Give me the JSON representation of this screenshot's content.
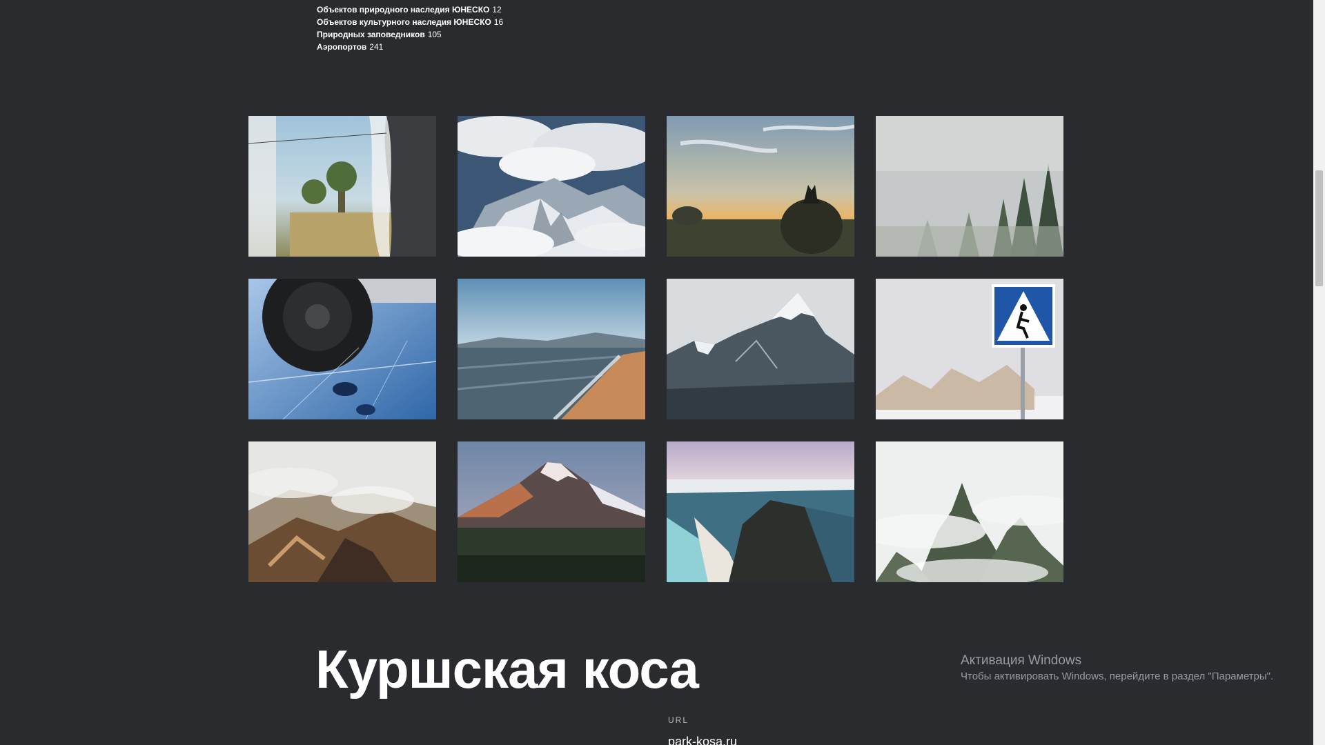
{
  "stats": [
    {
      "label": "Объектов природного наследия ЮНЕСКО",
      "value": "12"
    },
    {
      "label": "Объектов культурного наследия ЮНЕСКО",
      "value": "16"
    },
    {
      "label": "Природных заповедников",
      "value": "105"
    },
    {
      "label": "Аэропортов",
      "value": "241"
    }
  ],
  "gallery": {
    "photos": [
      {
        "subject": "train-window-photo"
      },
      {
        "subject": "clouds-over-mountains-photo"
      },
      {
        "subject": "wolf-on-hay-bale-photo"
      },
      {
        "subject": "foggy-forest-photo"
      },
      {
        "subject": "car-wheel-on-ice-photo"
      },
      {
        "subject": "lake-shore-photo"
      },
      {
        "subject": "snowy-peak-photo"
      },
      {
        "subject": "crosswalk-sign-photo"
      },
      {
        "subject": "volcanic-valley-photo"
      },
      {
        "subject": "volcano-photo"
      },
      {
        "subject": "coastal-cliff-photo"
      },
      {
        "subject": "misty-peaks-photo"
      }
    ]
  },
  "region": {
    "title": "Куршская коса",
    "url_label": "URL",
    "url": "park-kosa.ru"
  },
  "windows_activation": {
    "title": "Активация Windows",
    "subtitle": "Чтобы активировать Windows, перейдите в раздел \"Параметры\"."
  }
}
